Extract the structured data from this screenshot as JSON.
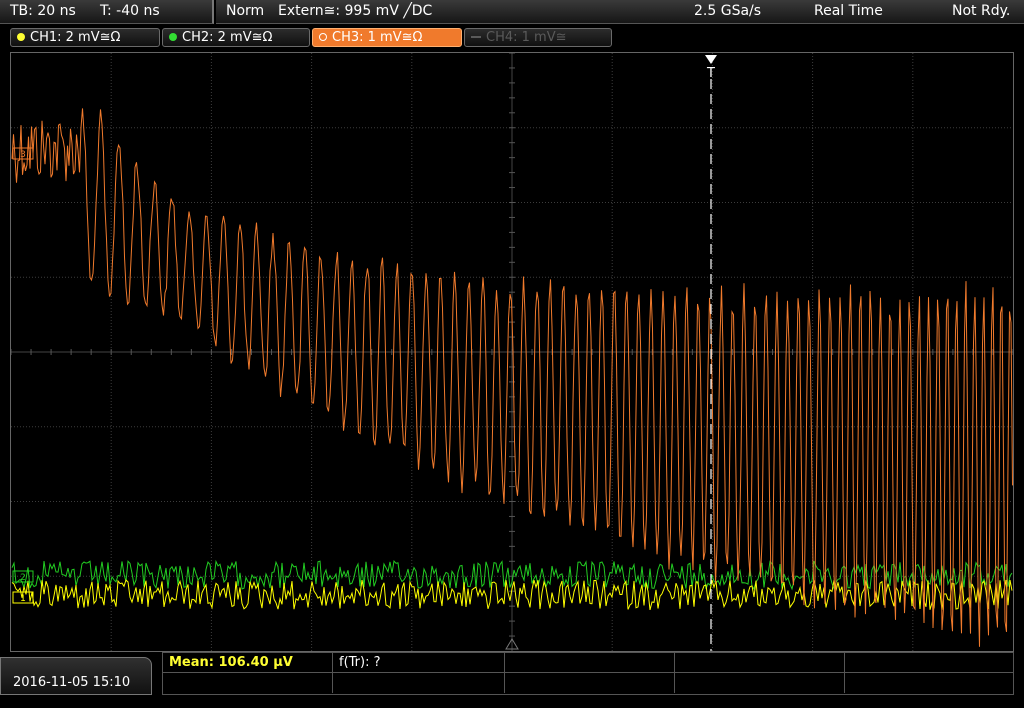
{
  "header": {
    "timebase": "TB: 20 ns",
    "trigger_offset": "T: -40 ns",
    "mode": "Norm",
    "trigger_source": "Extern≅: 995 mV ╱DC",
    "sample_rate": "2.5 GSa/s",
    "acq_mode": "Real Time",
    "status": "Not Rdy."
  },
  "channels": [
    {
      "label": "CH1: 2 mV≅Ω",
      "color": "#ffff33",
      "active": true
    },
    {
      "label": "CH2: 2 mV≅Ω",
      "color": "#33dd33",
      "active": true
    },
    {
      "label": "CH3: 1 mV≅Ω",
      "color": "#ff8040",
      "active": true,
      "selected": true
    },
    {
      "label": "CH4: 1 mV≅",
      "color": "#5a5a5a",
      "active": false
    }
  ],
  "trigger_marker": "T",
  "channel_markers": {
    "ch1": "1",
    "ch2": "2",
    "ch3": "3"
  },
  "colors": {
    "ch1": "#ffff00",
    "ch2": "#22cc22",
    "ch3": "#f07a2c",
    "grid": "#3a3a3a",
    "background": "#000000"
  },
  "footer": {
    "datetime": "2016-11-05 15:10",
    "measurement": "Mean: 106.40 µV",
    "measurement_color": "#ffff33",
    "measurement2": "f(Tr): ?"
  }
}
